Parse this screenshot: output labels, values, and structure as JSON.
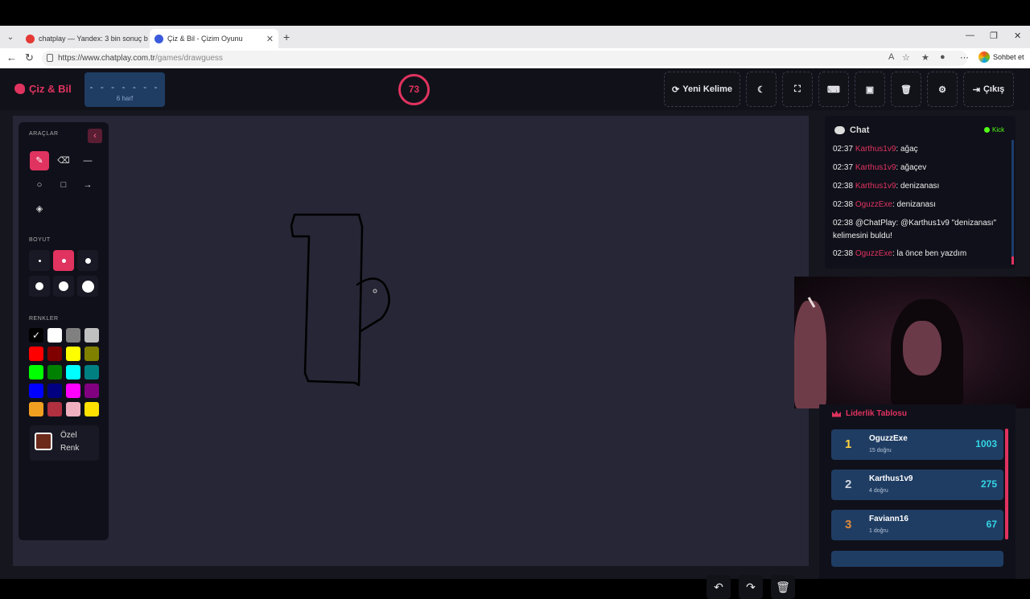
{
  "browser": {
    "tabs": [
      {
        "label": "chatplay — Yandex: 3 bin sonuç b",
        "icon_color": "#e53935"
      },
      {
        "label": "Çiz & Bil - Çizim Oyunu",
        "icon_color": "#3b5bdb"
      }
    ],
    "url_host": "https://www.chatplay.com.tr",
    "url_path": "/games/drawguess",
    "sohbet_label": "Sohbet et"
  },
  "header": {
    "logo": "Çiz & Bil",
    "word_mask": "- - - - - - -",
    "word_hint": "6 harf",
    "timer": "73",
    "new_word": "Yeni Kelime",
    "exit": "Çıkış"
  },
  "tools": {
    "section_tools": "ARAÇLAR",
    "section_size": "BOYUT",
    "section_colors": "RENKLER",
    "custom_color_label": "Özel Renk",
    "custom_color": "#6b2a1a",
    "colors": [
      "#000000",
      "#ffffff",
      "#808080",
      "#c0c0c0",
      "#ff0000",
      "#800000",
      "#ffff00",
      "#808000",
      "#00ff00",
      "#008000",
      "#00ffff",
      "#008080",
      "#0000ff",
      "#000080",
      "#ff00ff",
      "#800080",
      "#f0a020",
      "#b03040",
      "#f0b0c0",
      "#ffe000"
    ]
  },
  "chat": {
    "title": "Chat",
    "platform": "Kick",
    "messages": [
      {
        "time": "02:37",
        "user": "Karthus1v9",
        "text": ": ağaç"
      },
      {
        "time": "02:37",
        "user": "Karthus1v9",
        "text": ": ağaçev"
      },
      {
        "time": "02:38",
        "user": "Karthus1v9",
        "text": ": denizanası"
      },
      {
        "time": "02:38",
        "user": "OguzzExe",
        "text": ": denizanası"
      },
      {
        "time": "02:38",
        "user": "",
        "text": "@ChatPlay: @Karthus1v9 \"denizanası\" kelimesini buldu!"
      },
      {
        "time": "02:38",
        "user": "OguzzExe",
        "text": ": la önce ben yazdım"
      }
    ]
  },
  "leaderboard": {
    "title": "Liderlik Tablosu",
    "rows": [
      {
        "rank": "1",
        "name": "OguzzExe",
        "count": "15 doğru",
        "score": "1003",
        "rank_color": "#ffd23f"
      },
      {
        "rank": "2",
        "name": "Karthus1v9",
        "count": "4 doğru",
        "score": "275",
        "rank_color": "#d0d6e0"
      },
      {
        "rank": "3",
        "name": "Faviann16",
        "count": "1 doğru",
        "score": "67",
        "rank_color": "#e08a3c"
      }
    ]
  }
}
